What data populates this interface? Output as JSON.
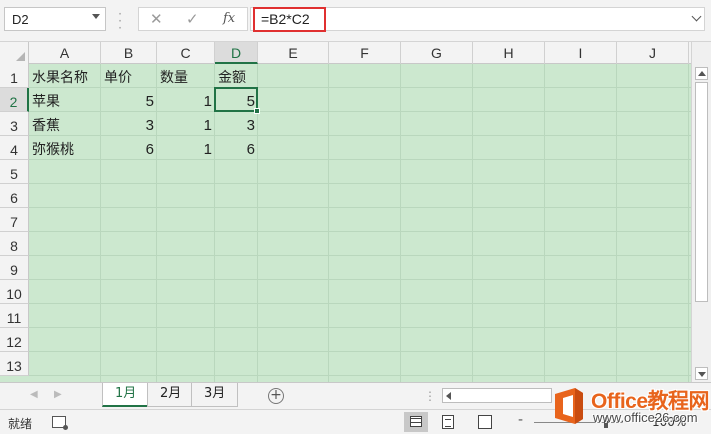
{
  "formula_bar": {
    "name_box": "D2",
    "cancel_glyph": "✕",
    "enter_glyph": "✓",
    "fx_label": "fx",
    "formula": "=B2*C2"
  },
  "grid": {
    "columns": [
      "A",
      "B",
      "C",
      "D",
      "E",
      "F",
      "G",
      "H",
      "I",
      "J"
    ],
    "rows": [
      "1",
      "2",
      "3",
      "4",
      "5",
      "6",
      "7",
      "8",
      "9",
      "10",
      "11",
      "12",
      "13"
    ],
    "selected_cell": "D2",
    "background_color": "#cce8cf",
    "accent_color": "#217346",
    "cells": [
      [
        "水果名称",
        "单价",
        "数量",
        "金额"
      ],
      [
        "苹果",
        "5",
        "1",
        "5"
      ],
      [
        "香蕉",
        "3",
        "1",
        "3"
      ],
      [
        "弥猴桃",
        "6",
        "1",
        "6"
      ]
    ]
  },
  "sheet_tabs": {
    "tabs": [
      "1月",
      "2月",
      "3月"
    ],
    "active": "1月",
    "add_glyph": "+"
  },
  "status_bar": {
    "status_text": "就绪",
    "zoom_minus": "-",
    "zoom_level": "100%",
    "zoom_fraction": 0.8
  },
  "watermark": {
    "brand_text": "Office教程网",
    "url_text": "www.office26.com",
    "brand_color": "#e8641c"
  }
}
